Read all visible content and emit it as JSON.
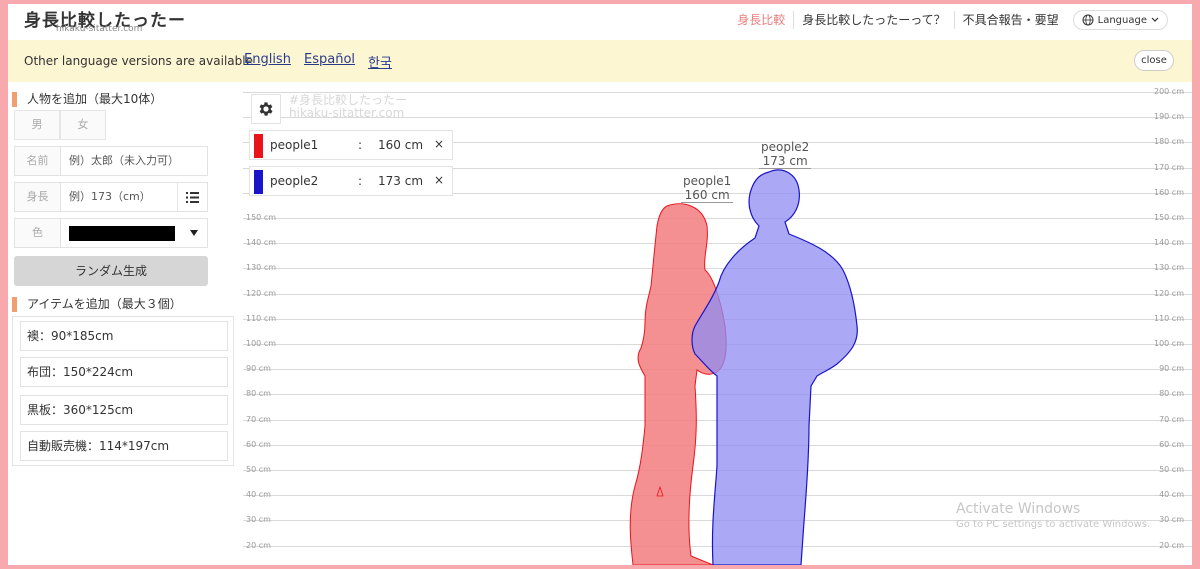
{
  "header": {
    "logo_title": "身長比較したったー",
    "logo_sub": "hikaku-sitatter.com",
    "nav": [
      "身長比較",
      "身長比較したったーって？",
      "不具合報告・要望"
    ],
    "language_label": "Language"
  },
  "langbar": {
    "message": "Other language versions are available",
    "links": [
      "English",
      "Español",
      "한국"
    ],
    "close_label": "close"
  },
  "sidebar": {
    "add_person_title": "人物を追加（最大10体）",
    "male_label": "男",
    "female_label": "女",
    "name_label": "名前",
    "name_placeholder": "例）太郎（未入力可）",
    "height_label": "身長",
    "height_placeholder": "例）173（cm）",
    "color_label": "色",
    "color_value": "#000000",
    "random_label": "ランダム生成",
    "add_item_title": "アイテムを追加（最大３個）",
    "items": [
      "襖：90*185cm",
      "布団：150*224cm",
      "黒板：360*125cm",
      "自動販売機：114*197cm"
    ]
  },
  "chart": {
    "watermark_line1": "#身長比較したったー",
    "watermark_line2": "hikaku-sitatter.com",
    "ticks": [
      "200 cm",
      "190 cm",
      "180 cm",
      "170 cm",
      "160 cm",
      "150 cm",
      "140 cm",
      "130 cm",
      "120 cm",
      "110 cm",
      "100 cm",
      "90 cm",
      "80 cm",
      "70 cm",
      "60 cm",
      "50 cm",
      "40 cm",
      "30 cm",
      "20 cm"
    ],
    "people": [
      {
        "name": "people1",
        "colon": ":",
        "height": "160 cm",
        "color": "#e8141b",
        "fill": "#f27c7f",
        "label_name": "people1",
        "label_height": "160 cm",
        "height_cm": 160
      },
      {
        "name": "people2",
        "colon": ":",
        "height": "173 cm",
        "color": "#1a14c9",
        "fill": "#8f8cf2",
        "label_name": "people2",
        "label_height": "173 cm",
        "height_cm": 173
      }
    ],
    "close_glyph": "×"
  },
  "overlay": {
    "title": "Activate Windows",
    "subtitle": "Go to PC settings to activate Windows."
  }
}
